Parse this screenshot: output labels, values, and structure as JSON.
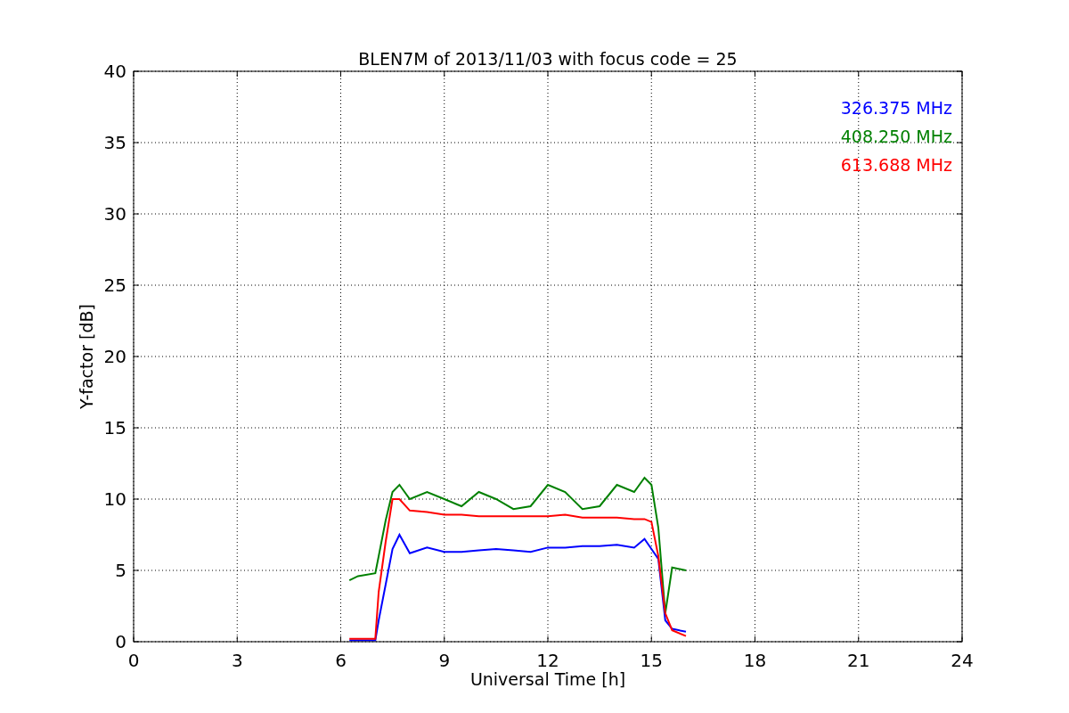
{
  "chart_data": {
    "type": "line",
    "title": "BLEN7M of 2013/11/03 with focus code = 25",
    "xlabel": "Universal Time [h]",
    "ylabel": "Y-factor [dB]",
    "x": [
      6.25,
      6.5,
      7,
      7.1,
      7.3,
      7.5,
      7.7,
      8,
      8.5,
      9,
      9.5,
      10,
      10.5,
      11,
      11.5,
      12,
      12.5,
      13,
      13.5,
      14,
      14.5,
      14.8,
      15,
      15.2,
      15.4,
      15.6,
      16
    ],
    "series": [
      {
        "name": "326.375 MHz",
        "color": "#0000ff",
        "values": [
          0.1,
          0.1,
          0.1,
          1.5,
          4,
          6.5,
          7.5,
          6.2,
          6.6,
          6.3,
          6.3,
          6.4,
          6.5,
          6.4,
          6.3,
          6.6,
          6.6,
          6.7,
          6.7,
          6.8,
          6.6,
          7.2,
          6.5,
          5.8,
          1.5,
          0.9,
          0.7
        ]
      },
      {
        "name": "408.250 MHz",
        "color": "#008000",
        "values": [
          4.3,
          4.6,
          4.8,
          6,
          8.5,
          10.5,
          11,
          10,
          10.5,
          10,
          9.5,
          10.5,
          10,
          9.3,
          9.5,
          11,
          10.5,
          9.3,
          9.5,
          11,
          10.5,
          11.5,
          11,
          8,
          2,
          5.2,
          5
        ]
      },
      {
        "name": "613.688 MHz",
        "color": "#ff0000",
        "values": [
          0.2,
          0.2,
          0.2,
          3.5,
          7,
          10,
          10,
          9.2,
          9.1,
          8.9,
          8.9,
          8.8,
          8.8,
          8.8,
          8.8,
          8.8,
          8.9,
          8.7,
          8.7,
          8.7,
          8.6,
          8.6,
          8.4,
          6,
          2,
          0.8,
          0.4
        ]
      }
    ],
    "grid": true,
    "xlim": [
      0,
      24
    ],
    "ylim": [
      0,
      40
    ],
    "xticks": [
      0,
      3,
      6,
      9,
      12,
      15,
      18,
      21,
      24
    ],
    "yticks": [
      0,
      5,
      10,
      15,
      20,
      25,
      30,
      35,
      40
    ]
  }
}
